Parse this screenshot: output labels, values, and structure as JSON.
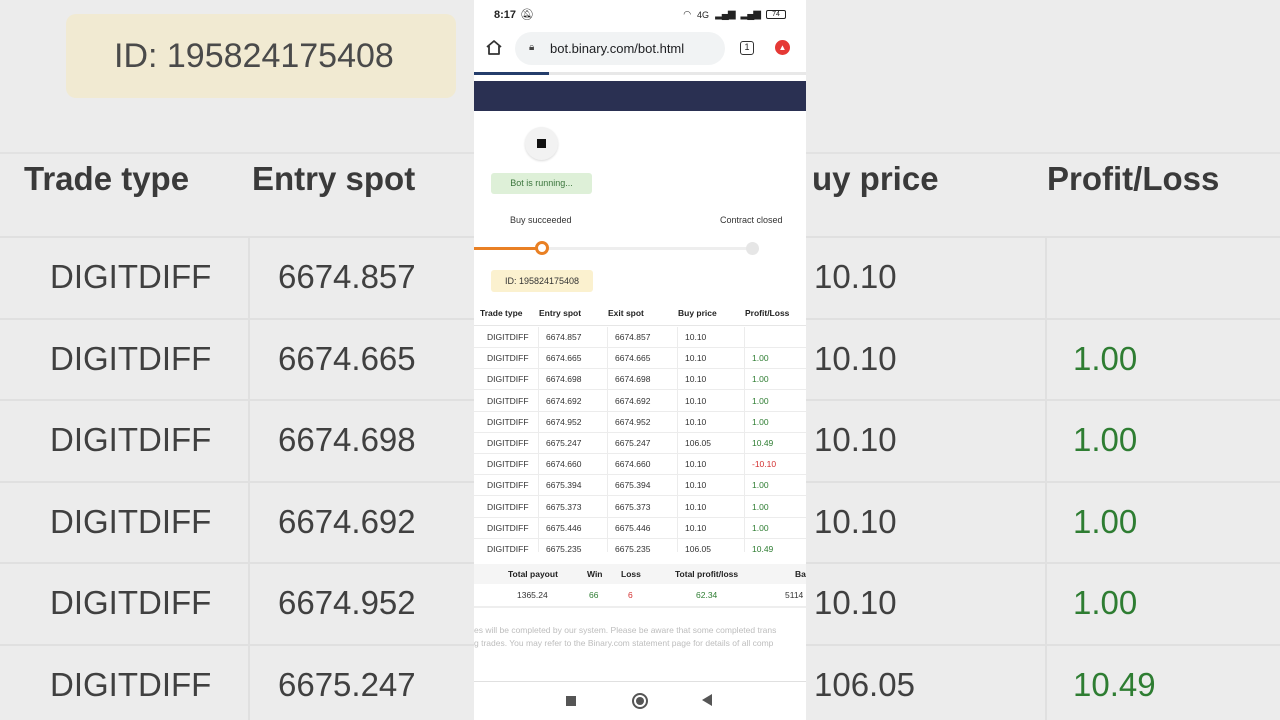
{
  "status_bar": {
    "time": "8:17",
    "battery": "74",
    "network": "4G"
  },
  "browser": {
    "url": "bot.binary.com/bot.html",
    "tab_count": "1"
  },
  "bot": {
    "status": "Bot is running...",
    "step_buy": "Buy succeeded",
    "step_closed": "Contract closed",
    "contract_id": "ID: 195824175408"
  },
  "table": {
    "headers": [
      "Trade type",
      "Entry spot",
      "Exit spot",
      "Buy price",
      "Profit/Loss"
    ],
    "rows": [
      [
        "DIGITDIFF",
        "6674.857",
        "6674.857",
        "10.10",
        ""
      ],
      [
        "DIGITDIFF",
        "6674.665",
        "6674.665",
        "10.10",
        "1.00"
      ],
      [
        "DIGITDIFF",
        "6674.698",
        "6674.698",
        "10.10",
        "1.00"
      ],
      [
        "DIGITDIFF",
        "6674.692",
        "6674.692",
        "10.10",
        "1.00"
      ],
      [
        "DIGITDIFF",
        "6674.952",
        "6674.952",
        "10.10",
        "1.00"
      ],
      [
        "DIGITDIFF",
        "6675.247",
        "6675.247",
        "106.05",
        "10.49"
      ],
      [
        "DIGITDIFF",
        "6674.660",
        "6674.660",
        "10.10",
        "-10.10"
      ],
      [
        "DIGITDIFF",
        "6675.394",
        "6675.394",
        "10.10",
        "1.00"
      ],
      [
        "DIGITDIFF",
        "6675.373",
        "6675.373",
        "10.10",
        "1.00"
      ],
      [
        "DIGITDIFF",
        "6675.446",
        "6675.446",
        "10.10",
        "1.00"
      ],
      [
        "DIGITDIFF",
        "6675.235",
        "6675.235",
        "106.05",
        "10.49"
      ]
    ]
  },
  "summary": {
    "headers": {
      "total_payout": "Total payout",
      "win": "Win",
      "loss": "Loss",
      "total_profit": "Total profit/loss",
      "balance": "Ba"
    },
    "values": {
      "total_payout": "1365.24",
      "win": "66",
      "loss": "6",
      "total_profit": "62.34",
      "balance": "5114"
    }
  },
  "disclaimer": {
    "line1": "es will be completed by our system. Please be aware that some completed trans",
    "line2": "g trades. You may refer to the Binary.com statement page for details of all comp"
  },
  "background": {
    "id_text": "ID: 195824175408",
    "headers": [
      "Trade type",
      "Entry spot",
      "uy price",
      "Profit/Loss"
    ],
    "rows": [
      [
        "DIGITDIFF",
        "6674.857",
        "10.10",
        ""
      ],
      [
        "DIGITDIFF",
        "6674.665",
        "10.10",
        "1.00"
      ],
      [
        "DIGITDIFF",
        "6674.698",
        "10.10",
        "1.00"
      ],
      [
        "DIGITDIFF",
        "6674.692",
        "10.10",
        "1.00"
      ],
      [
        "DIGITDIFF",
        "6674.952",
        "10.10",
        "1.00"
      ],
      [
        "DIGITDIFF",
        "6675.247",
        "106.05",
        "10.49"
      ]
    ]
  }
}
